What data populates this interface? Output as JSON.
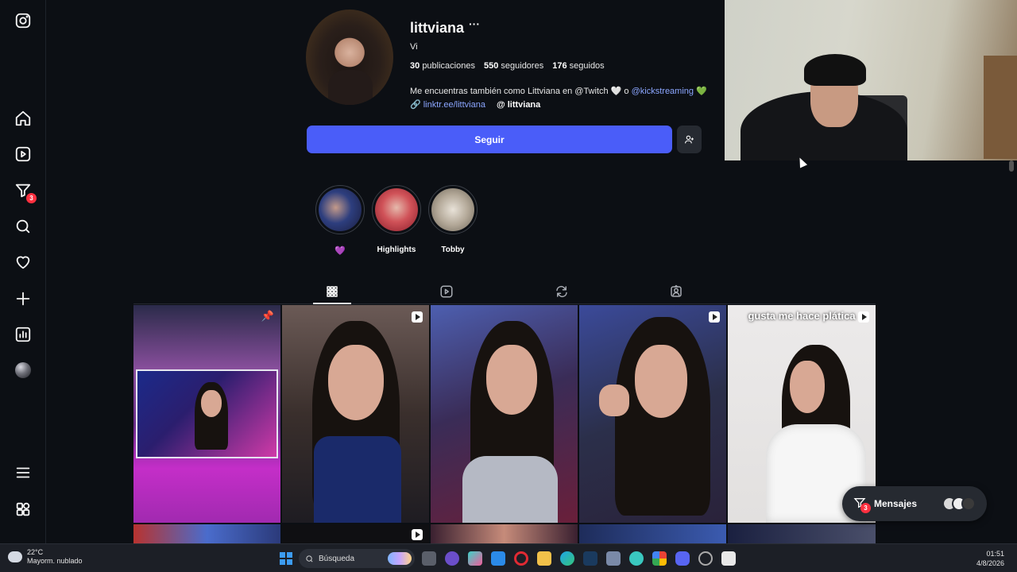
{
  "sidebar": {
    "items": [
      {
        "name": "instagram-logo-icon"
      },
      {
        "name": "home-icon"
      },
      {
        "name": "reels-icon"
      },
      {
        "name": "messages-icon",
        "badge": "3"
      },
      {
        "name": "search-icon"
      },
      {
        "name": "heart-icon"
      },
      {
        "name": "create-icon"
      },
      {
        "name": "dashboard-icon"
      },
      {
        "name": "profile-avatar"
      },
      {
        "name": "menu-icon"
      },
      {
        "name": "apps-icon"
      }
    ]
  },
  "profile": {
    "username": "littviana",
    "more": "···",
    "full_name": "Vi",
    "stats": {
      "posts_count": "30",
      "posts_label": "publicaciones",
      "followers_count": "550",
      "followers_label": "seguidores",
      "following_count": "176",
      "following_label": "seguidos"
    },
    "bio_text": "Me encuentras también como Littviana en @Twitch 🤍 o ",
    "bio_mention": "@kickstreaming",
    "bio_heart": "💚",
    "link": "linktr.ee/littviana",
    "threads": "littviana",
    "follow_label": "Seguir"
  },
  "highlights": [
    {
      "label": "💜"
    },
    {
      "label": "Highlights"
    },
    {
      "label": "Tobby"
    }
  ],
  "tabs": [
    "posts-grid",
    "reels",
    "reposts",
    "tagged"
  ],
  "posts": {
    "caption_5": "gusta me hace plática"
  },
  "messages": {
    "label": "Mensajes",
    "badge": "3"
  },
  "taskbar": {
    "temperature": "22°C",
    "weather": "Mayorm. nublado",
    "search_placeholder": "Búsqueda",
    "time": "01:51",
    "date": "4/8/2026"
  },
  "colors": {
    "background": "#0c0f14",
    "follow_button": "#4a5df9",
    "link": "#8ba6ff",
    "badge": "#ff3040"
  }
}
